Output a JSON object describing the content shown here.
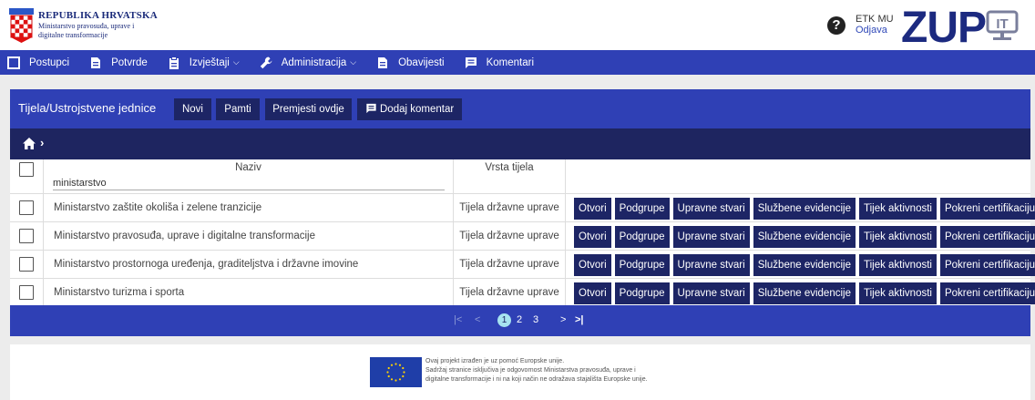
{
  "header": {
    "brand_title": "REPUBLIKA HRVATSKA",
    "brand_sub": "Ministarstvo pravosuđa, uprave i digitalne transformacije",
    "user_name": "ETK MU",
    "logout_label": "Odjava",
    "logo_text": "ZUP",
    "logo_badge": "IT"
  },
  "nav": {
    "items": [
      {
        "label": "Postupci",
        "icon": "window-icon"
      },
      {
        "label": "Potvrde",
        "icon": "document-icon"
      },
      {
        "label": "Izvještaji",
        "icon": "clipboard-icon",
        "dropdown": true
      },
      {
        "label": "Administracija",
        "icon": "wrench-icon",
        "dropdown": true
      },
      {
        "label": "Obavijesti",
        "icon": "document-icon"
      },
      {
        "label": "Komentari",
        "icon": "comment-icon"
      }
    ]
  },
  "panel": {
    "title": "Tijela/Ustrojstvene jednice",
    "buttons": {
      "novi": "Novi",
      "pamti": "Pamti",
      "premjesti": "Premjesti ovdje",
      "komentar": "Dodaj komentar"
    }
  },
  "table": {
    "columns": {
      "naziv": "Naziv",
      "vrsta": "Vrsta tijela"
    },
    "filter_value": "ministarstvo",
    "action_labels": {
      "otvori": "Otvori",
      "podgrupe": "Podgrupe",
      "upravne": "Upravne stvari",
      "sluzbene": "Službene evidencije",
      "tijek": "Tijek aktivnosti",
      "pokreni": "Pokreni certifikaciju"
    },
    "rows": [
      {
        "naziv": "Ministarstvo zaštite okoliša i zelene tranzicije",
        "vrsta": "Tijela državne uprave"
      },
      {
        "naziv": "Ministarstvo pravosuđa, uprave i digitalne transformacije",
        "vrsta": "Tijela državne uprave"
      },
      {
        "naziv": "Ministarstvo prostornoga uređenja, graditeljstva i državne imovine",
        "vrsta": "Tijela državne uprave"
      },
      {
        "naziv": "Ministarstvo turizma i sporta",
        "vrsta": "Tijela državne uprave"
      }
    ]
  },
  "pager": {
    "first": "|<",
    "prev": "<",
    "pages": [
      "1",
      "2",
      "3"
    ],
    "current_page": "1",
    "next": ">",
    "last": ">|"
  },
  "footer": {
    "line1": "Ovaj projekt izrađen je uz pomoć Europske unije.",
    "line2": "Sadržaj stranice isključiva je odgovornost Ministarstva pravosuđa, uprave i",
    "line3": "digitalne transformacije i ni na koji način ne odražava stajališta Europske unije."
  },
  "colors": {
    "primary": "#2f40b5",
    "dark": "#1d2565",
    "breadcrumb": "#1e2560",
    "page_active": "#a7e3f0"
  }
}
